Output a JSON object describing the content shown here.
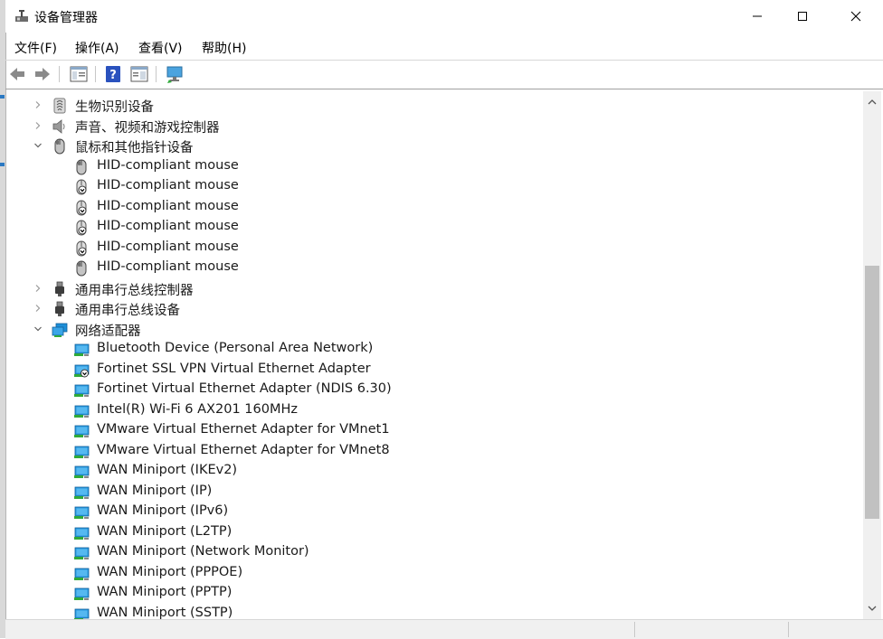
{
  "window": {
    "title": "设备管理器",
    "minimize_icon": "minimize-icon",
    "maximize_icon": "maximize-icon",
    "close_icon": "close-icon"
  },
  "menu": {
    "items": [
      "文件(F)",
      "操作(A)",
      "查看(V)",
      "帮助(H)"
    ]
  },
  "toolbar": {
    "icons": [
      "back-arrow-icon",
      "forward-arrow-icon",
      "show-hide-tree-icon",
      "help-icon",
      "properties-icon",
      "scan-hardware-icon"
    ]
  },
  "tree": {
    "rows": [
      {
        "kind": "category",
        "expanded": false,
        "icon": "biometric-icon",
        "label": "生物识别设备"
      },
      {
        "kind": "category",
        "expanded": false,
        "icon": "speaker-icon",
        "label": "声音、视频和游戏控制器"
      },
      {
        "kind": "category",
        "expanded": true,
        "icon": "mouse-icon",
        "label": "鼠标和其他指针设备"
      },
      {
        "kind": "device",
        "icon": "mouse-icon",
        "label": "HID-compliant mouse"
      },
      {
        "kind": "device",
        "icon": "mouse-disabled-icon",
        "label": "HID-compliant mouse"
      },
      {
        "kind": "device",
        "icon": "mouse-disabled-icon",
        "label": "HID-compliant mouse"
      },
      {
        "kind": "device",
        "icon": "mouse-disabled-icon",
        "label": "HID-compliant mouse"
      },
      {
        "kind": "device",
        "icon": "mouse-disabled-icon",
        "label": "HID-compliant mouse"
      },
      {
        "kind": "device",
        "icon": "mouse-icon",
        "label": "HID-compliant mouse"
      },
      {
        "kind": "category",
        "expanded": false,
        "icon": "usb-icon",
        "label": "通用串行总线控制器"
      },
      {
        "kind": "category",
        "expanded": false,
        "icon": "usb-icon",
        "label": "通用串行总线设备"
      },
      {
        "kind": "category",
        "expanded": true,
        "icon": "network-icon",
        "label": "网络适配器"
      },
      {
        "kind": "device",
        "icon": "network-adapter-icon",
        "label": "Bluetooth Device (Personal Area Network)"
      },
      {
        "kind": "device",
        "icon": "network-adapter-disabled-icon",
        "label": "Fortinet SSL VPN Virtual Ethernet Adapter"
      },
      {
        "kind": "device",
        "icon": "network-adapter-icon",
        "label": "Fortinet Virtual Ethernet Adapter (NDIS 6.30)"
      },
      {
        "kind": "device",
        "icon": "network-adapter-icon",
        "label": "Intel(R) Wi-Fi 6 AX201 160MHz"
      },
      {
        "kind": "device",
        "icon": "network-adapter-icon",
        "label": "VMware Virtual Ethernet Adapter for VMnet1"
      },
      {
        "kind": "device",
        "icon": "network-adapter-icon",
        "label": "VMware Virtual Ethernet Adapter for VMnet8"
      },
      {
        "kind": "device",
        "icon": "network-adapter-icon",
        "label": "WAN Miniport (IKEv2)"
      },
      {
        "kind": "device",
        "icon": "network-adapter-icon",
        "label": "WAN Miniport (IP)"
      },
      {
        "kind": "device",
        "icon": "network-adapter-icon",
        "label": "WAN Miniport (IPv6)"
      },
      {
        "kind": "device",
        "icon": "network-adapter-icon",
        "label": "WAN Miniport (L2TP)"
      },
      {
        "kind": "device",
        "icon": "network-adapter-icon",
        "label": "WAN Miniport (Network Monitor)"
      },
      {
        "kind": "device",
        "icon": "network-adapter-icon",
        "label": "WAN Miniport (PPPOE)"
      },
      {
        "kind": "device",
        "icon": "network-adapter-icon",
        "label": "WAN Miniport (PPTP)"
      },
      {
        "kind": "device",
        "icon": "network-adapter-icon",
        "label": "WAN Miniport (SSTP)"
      }
    ]
  },
  "scrollbar": {
    "position_fraction": 0.38,
    "visible_fraction": 0.5
  },
  "colors": {
    "network_blue": "#1e8fd8",
    "accent_green": "#2faa3a",
    "chevron": "#606060"
  }
}
